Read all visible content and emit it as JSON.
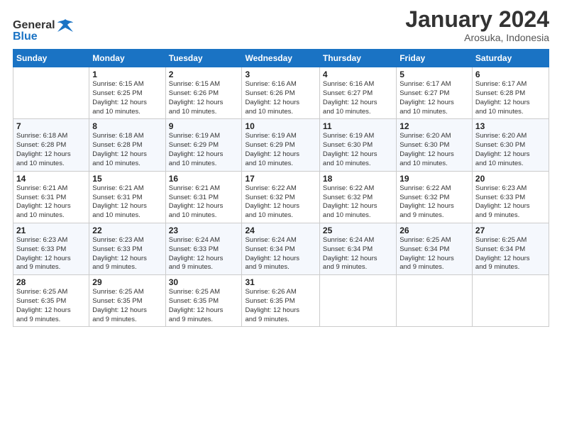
{
  "logo": {
    "line1": "General",
    "line2": "Blue",
    "icon_color": "#1a73c4"
  },
  "title": "January 2024",
  "location": "Arosuka, Indonesia",
  "days_header": [
    "Sunday",
    "Monday",
    "Tuesday",
    "Wednesday",
    "Thursday",
    "Friday",
    "Saturday"
  ],
  "weeks": [
    [
      {
        "day": "",
        "info": ""
      },
      {
        "day": "1",
        "info": "Sunrise: 6:15 AM\nSunset: 6:25 PM\nDaylight: 12 hours\nand 10 minutes."
      },
      {
        "day": "2",
        "info": "Sunrise: 6:15 AM\nSunset: 6:26 PM\nDaylight: 12 hours\nand 10 minutes."
      },
      {
        "day": "3",
        "info": "Sunrise: 6:16 AM\nSunset: 6:26 PM\nDaylight: 12 hours\nand 10 minutes."
      },
      {
        "day": "4",
        "info": "Sunrise: 6:16 AM\nSunset: 6:27 PM\nDaylight: 12 hours\nand 10 minutes."
      },
      {
        "day": "5",
        "info": "Sunrise: 6:17 AM\nSunset: 6:27 PM\nDaylight: 12 hours\nand 10 minutes."
      },
      {
        "day": "6",
        "info": "Sunrise: 6:17 AM\nSunset: 6:28 PM\nDaylight: 12 hours\nand 10 minutes."
      }
    ],
    [
      {
        "day": "7",
        "info": ""
      },
      {
        "day": "8",
        "info": "Sunrise: 6:18 AM\nSunset: 6:28 PM\nDaylight: 12 hours\nand 10 minutes."
      },
      {
        "day": "9",
        "info": "Sunrise: 6:19 AM\nSunset: 6:29 PM\nDaylight: 12 hours\nand 10 minutes."
      },
      {
        "day": "10",
        "info": "Sunrise: 6:19 AM\nSunset: 6:29 PM\nDaylight: 12 hours\nand 10 minutes."
      },
      {
        "day": "11",
        "info": "Sunrise: 6:19 AM\nSunset: 6:30 PM\nDaylight: 12 hours\nand 10 minutes."
      },
      {
        "day": "12",
        "info": "Sunrise: 6:20 AM\nSunset: 6:30 PM\nDaylight: 12 hours\nand 10 minutes."
      },
      {
        "day": "13",
        "info": "Sunrise: 6:20 AM\nSunset: 6:30 PM\nDaylight: 12 hours\nand 10 minutes."
      }
    ],
    [
      {
        "day": "14",
        "info": ""
      },
      {
        "day": "15",
        "info": "Sunrise: 6:21 AM\nSunset: 6:31 PM\nDaylight: 12 hours\nand 10 minutes."
      },
      {
        "day": "16",
        "info": "Sunrise: 6:21 AM\nSunset: 6:31 PM\nDaylight: 12 hours\nand 10 minutes."
      },
      {
        "day": "17",
        "info": "Sunrise: 6:22 AM\nSunset: 6:32 PM\nDaylight: 12 hours\nand 10 minutes."
      },
      {
        "day": "18",
        "info": "Sunrise: 6:22 AM\nSunset: 6:32 PM\nDaylight: 12 hours\nand 10 minutes."
      },
      {
        "day": "19",
        "info": "Sunrise: 6:22 AM\nSunset: 6:32 PM\nDaylight: 12 hours\nand 9 minutes."
      },
      {
        "day": "20",
        "info": "Sunrise: 6:23 AM\nSunset: 6:33 PM\nDaylight: 12 hours\nand 9 minutes."
      }
    ],
    [
      {
        "day": "21",
        "info": ""
      },
      {
        "day": "22",
        "info": "Sunrise: 6:23 AM\nSunset: 6:33 PM\nDaylight: 12 hours\nand 9 minutes."
      },
      {
        "day": "23",
        "info": "Sunrise: 6:24 AM\nSunset: 6:33 PM\nDaylight: 12 hours\nand 9 minutes."
      },
      {
        "day": "24",
        "info": "Sunrise: 6:24 AM\nSunset: 6:34 PM\nDaylight: 12 hours\nand 9 minutes."
      },
      {
        "day": "25",
        "info": "Sunrise: 6:24 AM\nSunset: 6:34 PM\nDaylight: 12 hours\nand 9 minutes."
      },
      {
        "day": "26",
        "info": "Sunrise: 6:25 AM\nSunset: 6:34 PM\nDaylight: 12 hours\nand 9 minutes."
      },
      {
        "day": "27",
        "info": "Sunrise: 6:25 AM\nSunset: 6:34 PM\nDaylight: 12 hours\nand 9 minutes."
      }
    ],
    [
      {
        "day": "28",
        "info": "Sunrise: 6:25 AM\nSunset: 6:35 PM\nDaylight: 12 hours\nand 9 minutes."
      },
      {
        "day": "29",
        "info": "Sunrise: 6:25 AM\nSunset: 6:35 PM\nDaylight: 12 hours\nand 9 minutes."
      },
      {
        "day": "30",
        "info": "Sunrise: 6:25 AM\nSunset: 6:35 PM\nDaylight: 12 hours\nand 9 minutes."
      },
      {
        "day": "31",
        "info": "Sunrise: 6:26 AM\nSunset: 6:35 PM\nDaylight: 12 hours\nand 9 minutes."
      },
      {
        "day": "",
        "info": ""
      },
      {
        "day": "",
        "info": ""
      },
      {
        "day": "",
        "info": ""
      }
    ]
  ],
  "week1_sunday_info": "Sunrise: 6:18 AM\nSunset: 6:28 PM\nDaylight: 12 hours\nand 10 minutes.",
  "week3_sunday_info": "Sunrise: 6:21 AM\nSunset: 6:31 PM\nDaylight: 12 hours\nand 10 minutes.",
  "week4_sunday_info": "Sunrise: 6:23 AM\nSunset: 6:33 PM\nDaylight: 12 hours\nand 9 minutes."
}
